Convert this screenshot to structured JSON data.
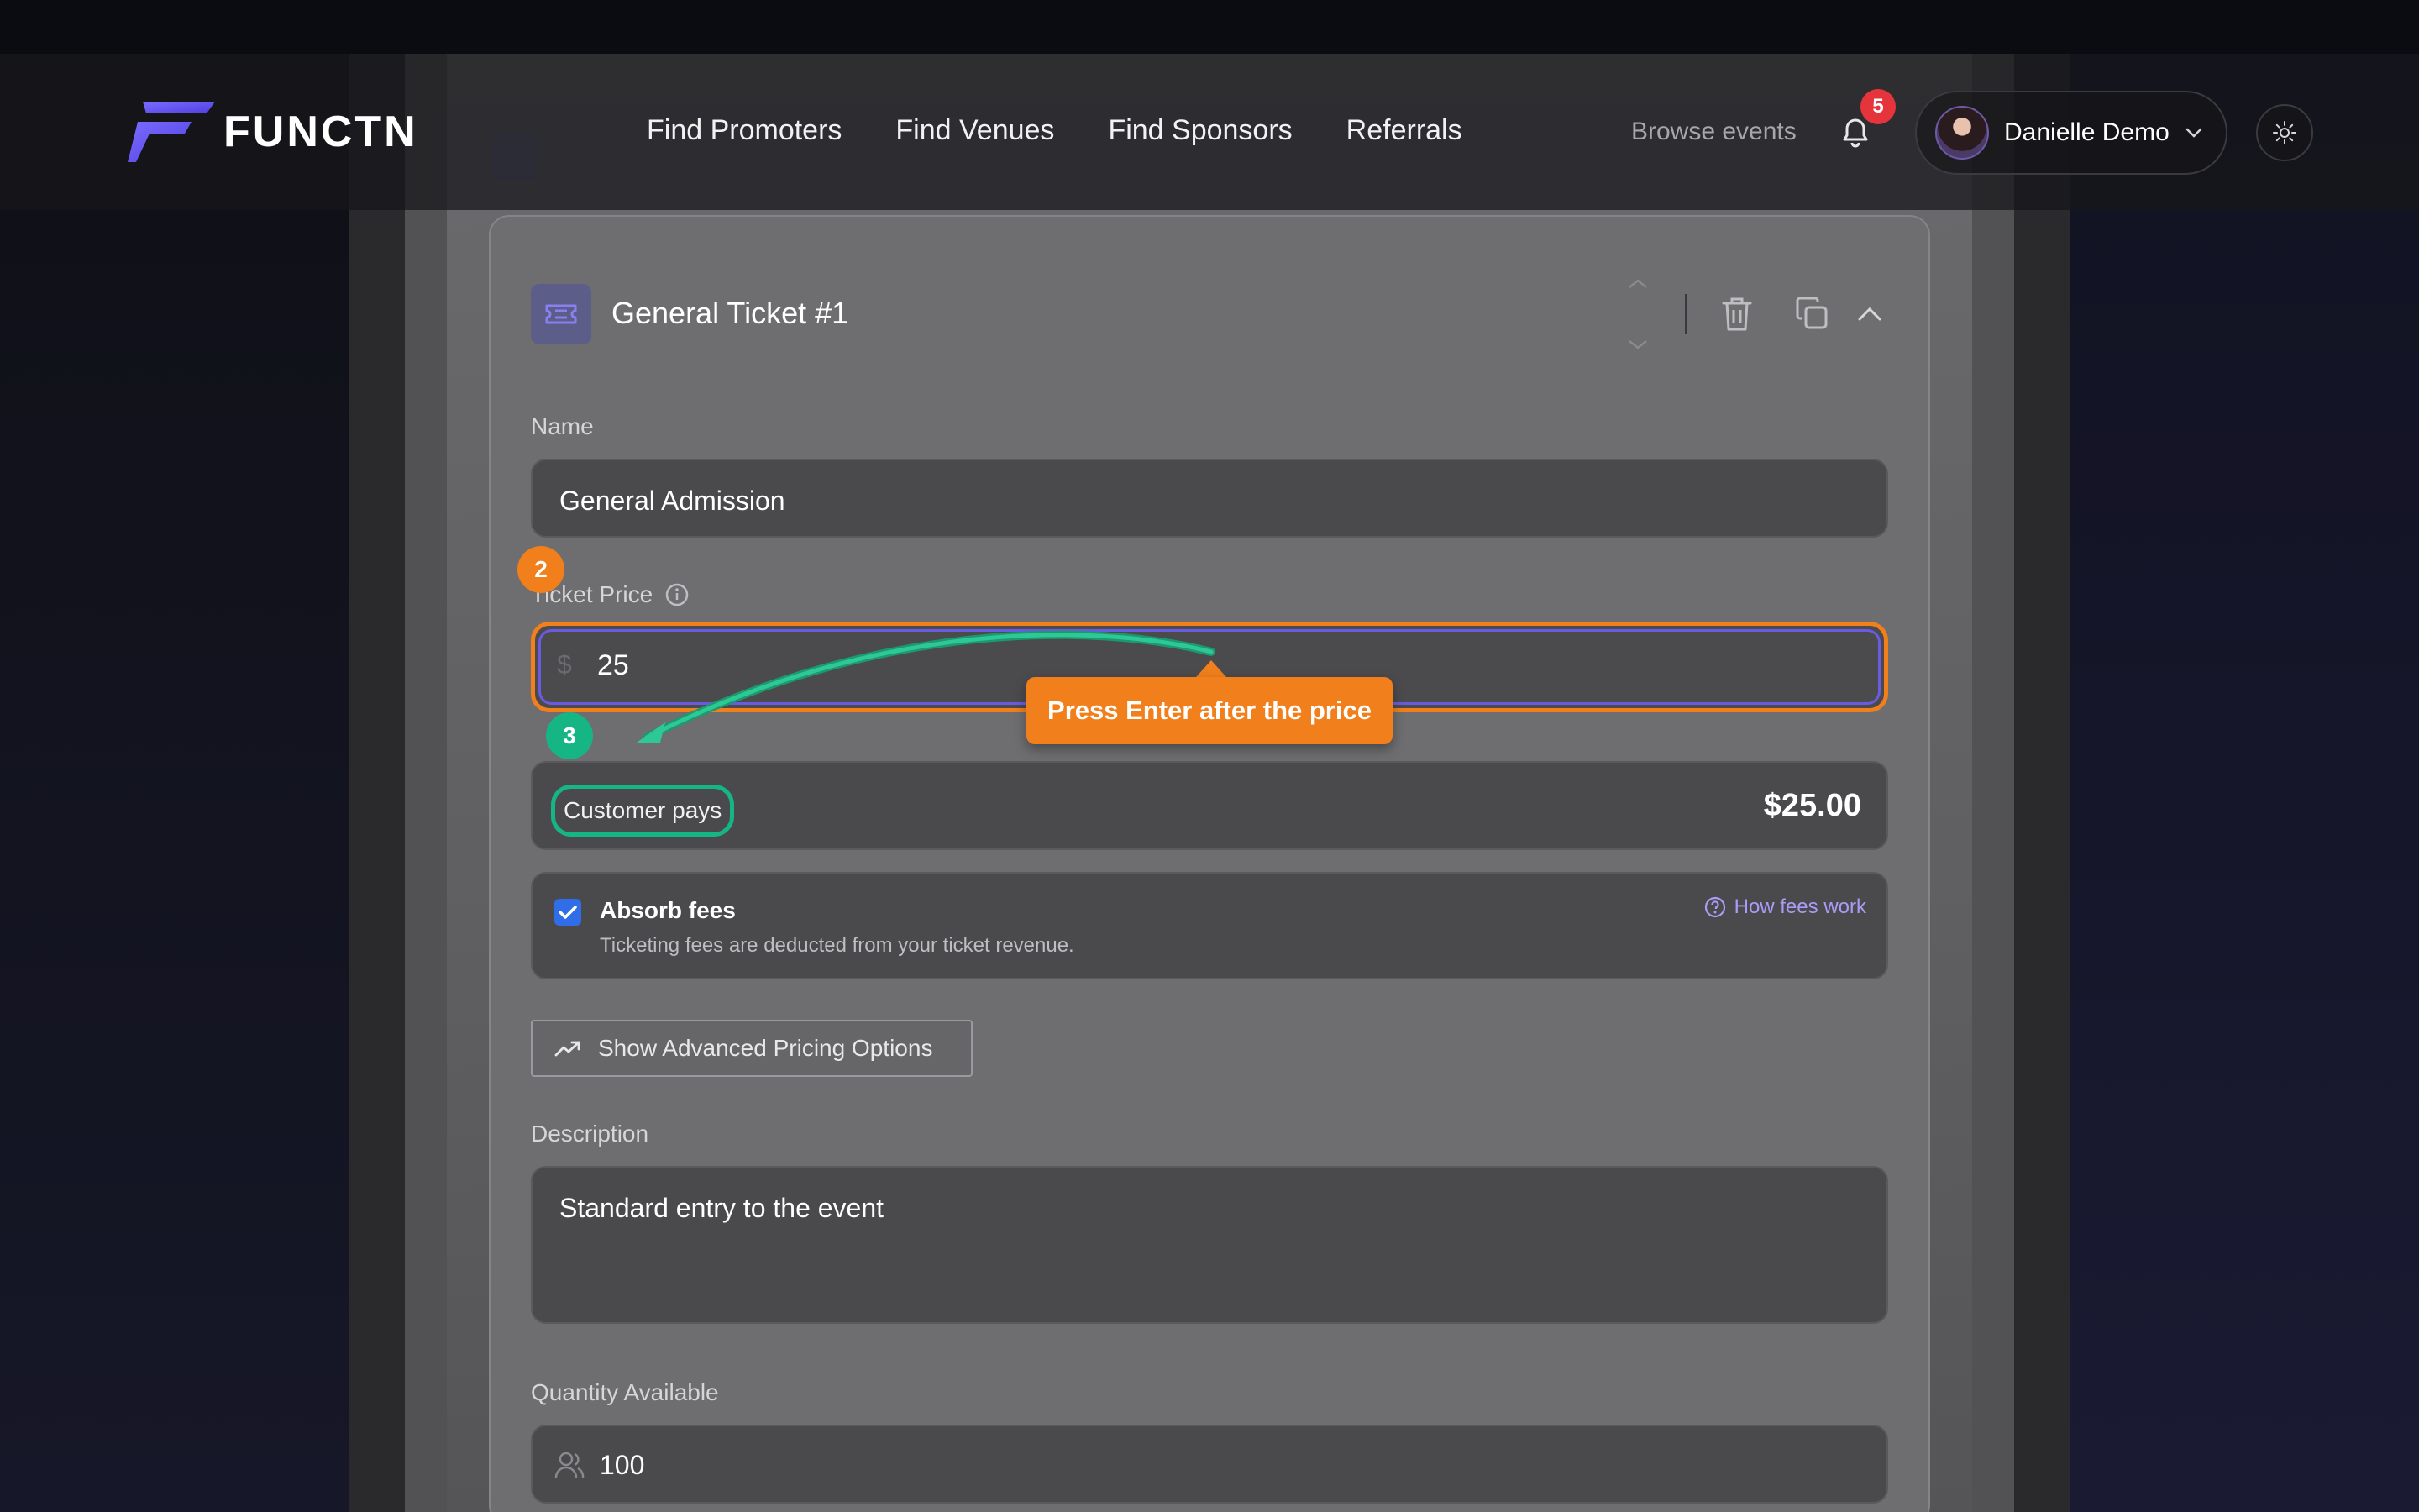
{
  "brand": {
    "name": "FUNCTN"
  },
  "nav": {
    "links": [
      "Find Promoters",
      "Find Venues",
      "Find Sponsors",
      "Referrals"
    ],
    "browse": "Browse events",
    "notifications_count": "5",
    "user_name": "Danielle Demo"
  },
  "ticket": {
    "title": "General Ticket #1",
    "name_label": "Name",
    "name_value": "General Admission",
    "price_label": "Ticket Price",
    "currency_symbol": "$",
    "price_value": "25",
    "customer_pays_label": "Customer pays",
    "customer_pays_value": "$25.00",
    "absorb_fees_label": "Absorb fees",
    "absorb_fees_checked": true,
    "absorb_fees_description": "Ticketing fees are deducted from your ticket revenue.",
    "how_fees_work": "How fees work",
    "advanced_pricing_label": "Show Advanced Pricing Options",
    "description_label": "Description",
    "description_value": "Standard entry to the event",
    "quantity_label": "Quantity Available",
    "quantity_value": "100"
  },
  "annotations": {
    "step_price": "2",
    "step_customer_pays": "3",
    "tooltip": "Press Enter after the price"
  },
  "colors": {
    "accent_orange": "#f07f1c",
    "accent_green": "#16b584",
    "accent_purple": "#6b5be0",
    "checkbox_blue": "#2f6ee8",
    "badge_red": "#e5343b"
  }
}
